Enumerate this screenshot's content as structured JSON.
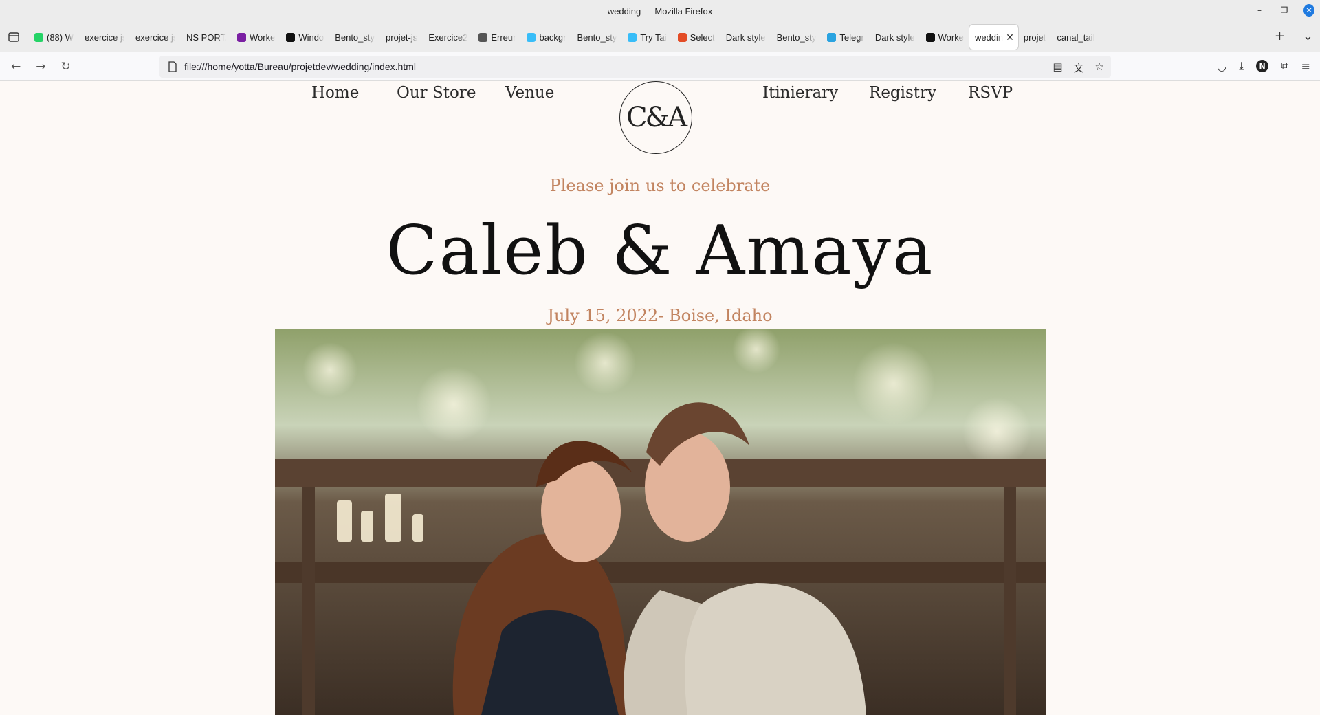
{
  "window": {
    "title": "wedding — Mozilla Firefox"
  },
  "tabs": [
    {
      "label": "(88) W",
      "fav": "#25d366"
    },
    {
      "label": "exercice js",
      "fav": ""
    },
    {
      "label": "exercice js",
      "fav": ""
    },
    {
      "label": "NS PORTA",
      "fav": ""
    },
    {
      "label": "Worke",
      "fav": "#7a1fa2"
    },
    {
      "label": "Windo",
      "fav": "#111111"
    },
    {
      "label": "Bento_sty",
      "fav": ""
    },
    {
      "label": "projet-js",
      "fav": ""
    },
    {
      "label": "Exercice2",
      "fav": ""
    },
    {
      "label": "Erreur",
      "fav": "#555555"
    },
    {
      "label": "backgr",
      "fav": "#38bdf8"
    },
    {
      "label": "Bento_sty",
      "fav": ""
    },
    {
      "label": "Try Tai",
      "fav": "#38bdf8"
    },
    {
      "label": "Select",
      "fav": "#e34c26"
    },
    {
      "label": "Dark style",
      "fav": ""
    },
    {
      "label": "Bento_sty",
      "fav": ""
    },
    {
      "label": "Telegr",
      "fav": "#2aa3e0"
    },
    {
      "label": "Dark style",
      "fav": ""
    },
    {
      "label": "Worke",
      "fav": "#111111"
    },
    {
      "label": "weddin",
      "fav": "",
      "active": true
    },
    {
      "label": "projet",
      "fav": ""
    },
    {
      "label": "canal_tail",
      "fav": ""
    }
  ],
  "url": "file:///home/yotta/Bureau/projetdev/wedding/index.html",
  "account_initial": "N",
  "site": {
    "nav_left": [
      "Home",
      "Our Store",
      "Venue"
    ],
    "nav_right": [
      "Itinierary",
      "Registry",
      "RSVP"
    ],
    "monogram": "C&A",
    "tagline": "Please join us to celebrate",
    "names": "Caleb & Amaya",
    "date_location": "July 15, 2022- Boise, Idaho"
  },
  "colors": {
    "accent": "#c28460",
    "background": "#fdf9f6",
    "text": "#111111"
  }
}
